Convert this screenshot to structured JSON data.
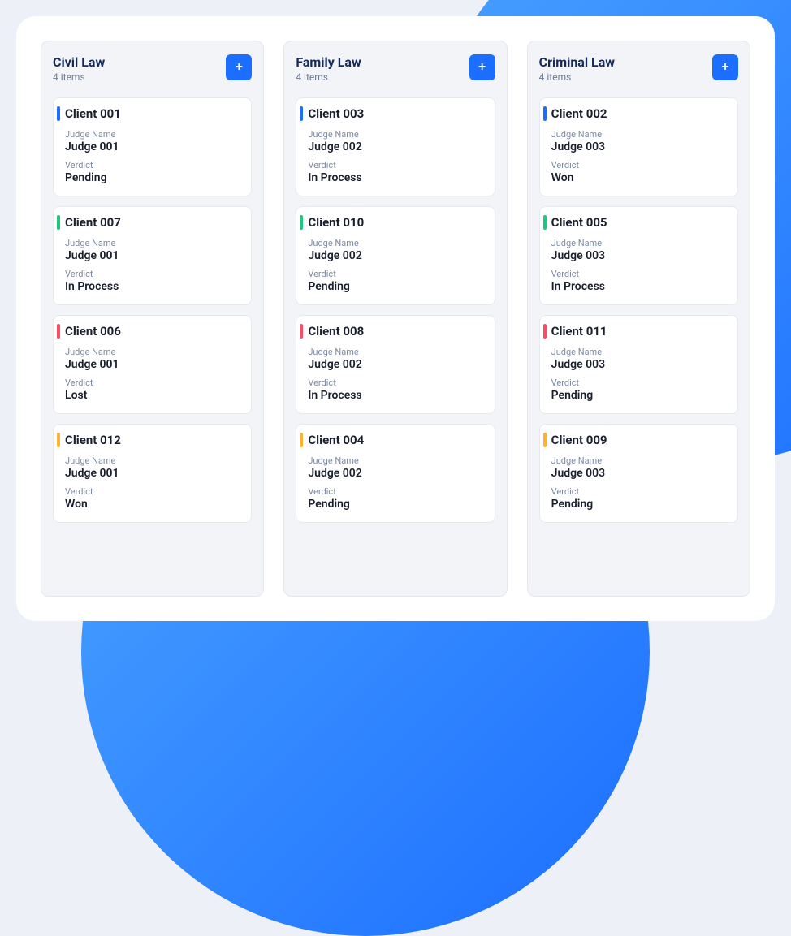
{
  "labels": {
    "judge_name": "Judge Name",
    "verdict": "Verdict",
    "items_suffix": " items"
  },
  "columns": [
    {
      "title": "Civil Law",
      "count": "4 items",
      "cards": [
        {
          "client": "Client 001",
          "judge": "Judge 001",
          "verdict": "Pending",
          "bar_color": "blue"
        },
        {
          "client": "Client 007",
          "judge": "Judge 001",
          "verdict": "In Process",
          "bar_color": "green"
        },
        {
          "client": "Client 006",
          "judge": "Judge 001",
          "verdict": "Lost",
          "bar_color": "red"
        },
        {
          "client": "Client 012",
          "judge": "Judge 001",
          "verdict": "Won",
          "bar_color": "amber"
        }
      ]
    },
    {
      "title": "Family Law",
      "count": "4 items",
      "cards": [
        {
          "client": "Client 003",
          "judge": "Judge 002",
          "verdict": "In Process",
          "bar_color": "blue"
        },
        {
          "client": "Client 010",
          "judge": "Judge 002",
          "verdict": "Pending",
          "bar_color": "green"
        },
        {
          "client": "Client 008",
          "judge": "Judge 002",
          "verdict": "In Process",
          "bar_color": "red"
        },
        {
          "client": "Client 004",
          "judge": "Judge 002",
          "verdict": "Pending",
          "bar_color": "amber"
        }
      ]
    },
    {
      "title": "Criminal Law",
      "count": "4 items",
      "cards": [
        {
          "client": "Client 002",
          "judge": "Judge 003",
          "verdict": "Won",
          "bar_color": "blue"
        },
        {
          "client": "Client 005",
          "judge": "Judge 003",
          "verdict": "In Process",
          "bar_color": "green"
        },
        {
          "client": "Client 011",
          "judge": "Judge 003",
          "verdict": "Pending",
          "bar_color": "red"
        },
        {
          "client": "Client 009",
          "judge": "Judge 003",
          "verdict": "Pending",
          "bar_color": "amber"
        }
      ]
    }
  ]
}
